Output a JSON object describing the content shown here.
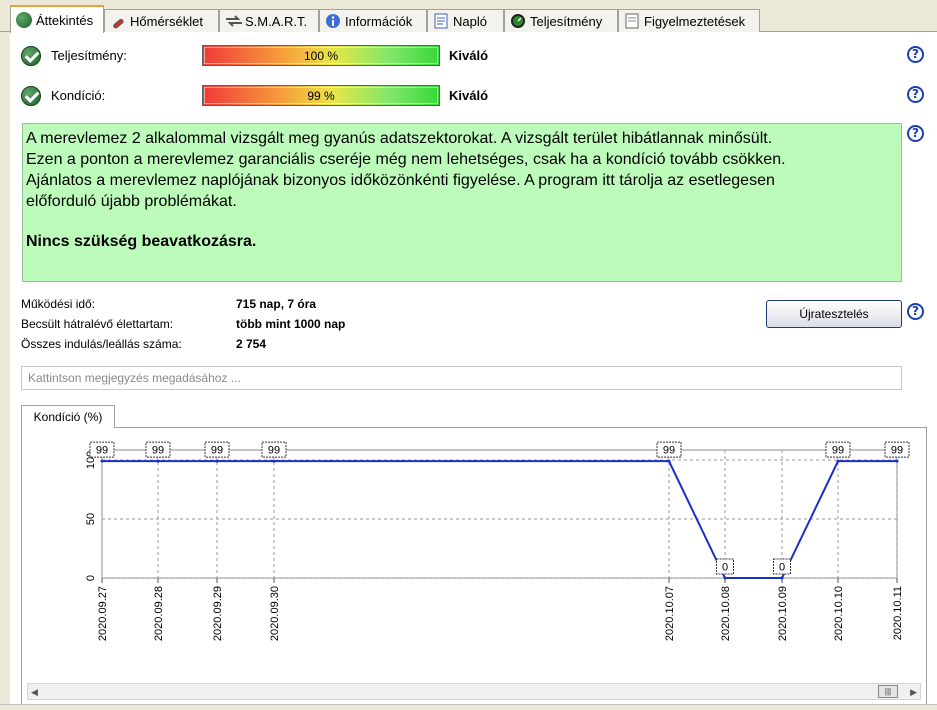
{
  "tabs": [
    {
      "label": "Áttekintés",
      "icon": "check-circle-icon",
      "active": true
    },
    {
      "label": "Hőmérséklet",
      "icon": "thermometer-icon"
    },
    {
      "label": "S.M.A.R.T.",
      "icon": "smart-arrows-icon"
    },
    {
      "label": "Információk",
      "icon": "info-icon"
    },
    {
      "label": "Napló",
      "icon": "log-document-icon"
    },
    {
      "label": "Teljesítmény",
      "icon": "gauge-icon"
    },
    {
      "label": "Figyelmeztetések",
      "icon": "alerts-document-icon"
    }
  ],
  "status": {
    "performance": {
      "label": "Teljesítmény:",
      "bar_text": "100 %",
      "value_percent": 100,
      "rating": "Kiváló"
    },
    "condition": {
      "label": "Kondíció:",
      "bar_text": "99 %",
      "value_percent": 99,
      "rating": "Kiváló"
    }
  },
  "message": {
    "lines": [
      "A merevlemez 2 alkalommal vizsgált meg gyanús adatszektorokat. A vizsgált terület hibátlannak minősült.",
      "Ezen a ponton a merevlemez garanciális cseréje még nem lehetséges, csak ha a kondíció tovább csökken.",
      "Ajánlatos a merevlemez naplójának bizonyos időközönkénti figyelése. A program itt tárolja az esetlegesen",
      "előforduló újabb problémákat."
    ],
    "conclusion": "Nincs szükség beavatkozásra.",
    "background": "#bdfbbb"
  },
  "info": {
    "uptime_label": "Működési idő:",
    "uptime_value": "715 nap, 7 óra",
    "remaining_label": "Becsült hátralévő élettartam:",
    "remaining_value": "több mint 1000 nap",
    "startstop_label": "Összes indulás/leállás száma:",
    "startstop_value": "2 754"
  },
  "retest_button": "Újratesztelés",
  "note_placeholder": "Kattintson megjegyzés megadásához ...",
  "chart_tab": "Kondíció  (%)",
  "chart_data": {
    "type": "line",
    "x": [
      "2020.09.27",
      "2020.09.28",
      "2020.09.29",
      "2020.09.30",
      "2020.10.07",
      "2020.10.08",
      "2020.10.09",
      "2020.10.10",
      "2020.10.11"
    ],
    "y": [
      99,
      99,
      99,
      99,
      99,
      0,
      0,
      99,
      99
    ],
    "data_labels": [
      "99",
      "99",
      "99",
      "99",
      "99",
      "0",
      "0",
      "99",
      "99"
    ],
    "y_ticks": [
      "0",
      "50",
      "100"
    ],
    "ylim": [
      0,
      100
    ],
    "grid": true,
    "line_color": "#1a2fc8"
  }
}
